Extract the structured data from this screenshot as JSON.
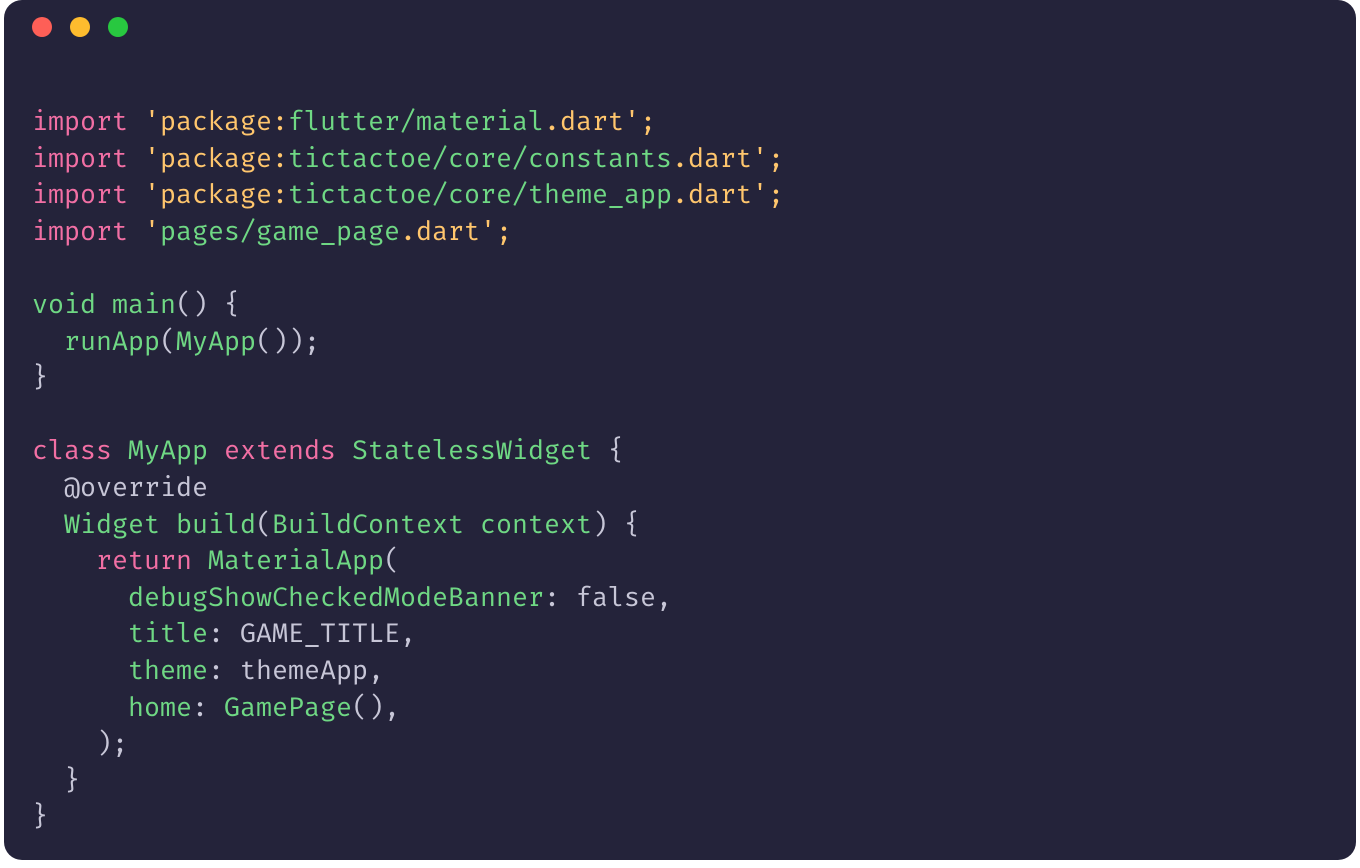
{
  "traffic_colors": {
    "close": "#fe5f57",
    "min": "#febc2e",
    "max": "#28c840"
  },
  "code": {
    "l1": {
      "kw": "import",
      "q": "'",
      "pkg": "package:",
      "path": "flutter/material",
      "ext": ".dart",
      "end": "';"
    },
    "l2": {
      "kw": "import",
      "q": "'",
      "pkg": "package:",
      "path": "tictactoe/core/constants",
      "ext": ".dart",
      "end": "';"
    },
    "l3": {
      "kw": "import",
      "q": "'",
      "pkg": "package:",
      "path": "tictactoe/core/theme_app",
      "ext": ".dart",
      "end": "';"
    },
    "l4": {
      "kw": "import",
      "q": "'",
      "path": "pages/game_page",
      "ext": ".dart",
      "end": "';"
    },
    "l6": {
      "t_void": "void",
      "t_main": "main",
      "paren": "()",
      "brace": " {"
    },
    "l7": {
      "indent": "  ",
      "fn": "runApp",
      "open": "(",
      "cls": "MyApp",
      "call": "()",
      "close": ");"
    },
    "l8": {
      "brace": "}"
    },
    "l10": {
      "kw_class": "class",
      "cls": "MyApp",
      "kw_ext": "extends",
      "base": "StatelessWidget",
      "brace": " {"
    },
    "l11": {
      "indent": "  ",
      "ann": "@override"
    },
    "l12": {
      "indent": "  ",
      "ret": "Widget",
      "fn": "build",
      "open": "(",
      "ptype": "BuildContext",
      "pname": "context",
      "close": ")",
      "brace": " {"
    },
    "l13": {
      "indent": "    ",
      "kw": "return",
      "cls": "MaterialApp",
      "open": "("
    },
    "l14": {
      "indent": "      ",
      "name": "debugShowCheckedModeBanner",
      "colon": ":",
      "val": " false",
      "comma": ","
    },
    "l15": {
      "indent": "      ",
      "name": "title",
      "colon": ":",
      "val": " GAME_TITLE",
      "comma": ","
    },
    "l16": {
      "indent": "      ",
      "name": "theme",
      "colon": ":",
      "val": " themeApp",
      "comma": ","
    },
    "l17": {
      "indent": "      ",
      "name": "home",
      "colon": ":",
      "cls": " GamePage",
      "call": "()",
      "comma": ","
    },
    "l18": {
      "indent": "    ",
      "close": ");"
    },
    "l19": {
      "indent": "  ",
      "brace": "}"
    },
    "l20": {
      "brace": "}"
    }
  }
}
